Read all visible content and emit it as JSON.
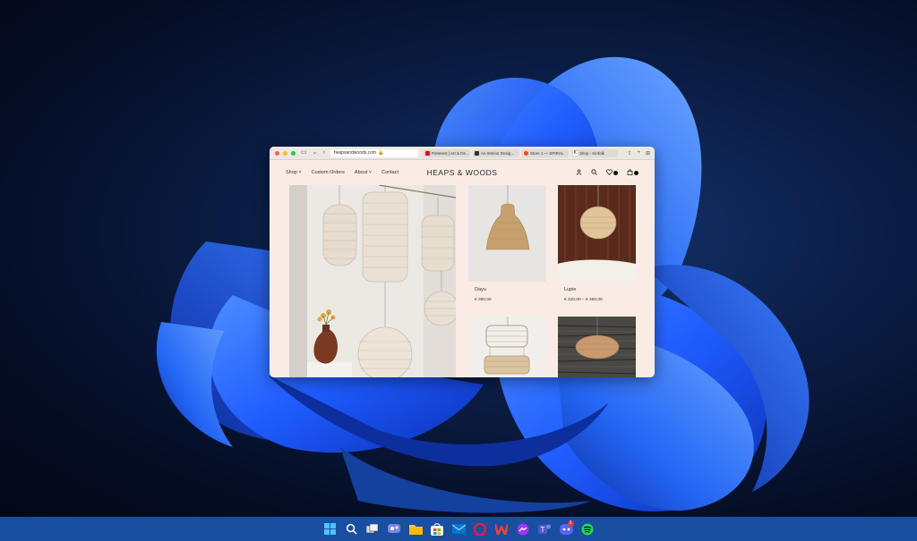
{
  "browser": {
    "address": "heapsandwoods.com",
    "tabs": [
      {
        "label": "Pinterest | Art & De...",
        "color": "#e60023"
      },
      {
        "label": "An Interior Desig...",
        "color": "#333333"
      },
      {
        "label": "Store 1 — SPIRAL",
        "color": "#ff4a00"
      },
      {
        "label": "Shop - Kinfolk",
        "color": "#222222"
      }
    ],
    "icons": {
      "back": "chevron-left-icon",
      "sidebar": "sidebar-icon",
      "share": "share-icon",
      "new_tab": "plus-icon",
      "tab_overview": "grid-icon"
    }
  },
  "site": {
    "logo": "HEAPS & WOODS",
    "nav": [
      "Shop",
      "Custom Orders",
      "About",
      "Contact"
    ],
    "header_icons": {
      "account": "user-icon",
      "search": "search-icon",
      "wishlist": "heart-icon",
      "cart": "bag-icon"
    },
    "products": [
      {
        "name": "Dayu",
        "price": "€ 350,00"
      },
      {
        "name": "Lupie",
        "price": "€ 220,00 – € 350,00"
      },
      {
        "name": "",
        "price": ""
      },
      {
        "name": "",
        "price": ""
      }
    ]
  },
  "taskbar": {
    "icons": [
      "windows-start-icon",
      "search-icon",
      "task-view-icon",
      "teams-chat-icon",
      "file-explorer-icon",
      "microsoft-store-icon",
      "mail-icon",
      "opera-icon",
      "wps-office-icon",
      "messenger-icon",
      "teams-icon",
      "discord-icon",
      "spotify-icon"
    ],
    "discord_badge": "1"
  },
  "colors": {
    "page_bg": "#faece4",
    "taskbar": "#1a4e9e",
    "wallpaper_blue": "#1f5cff"
  }
}
